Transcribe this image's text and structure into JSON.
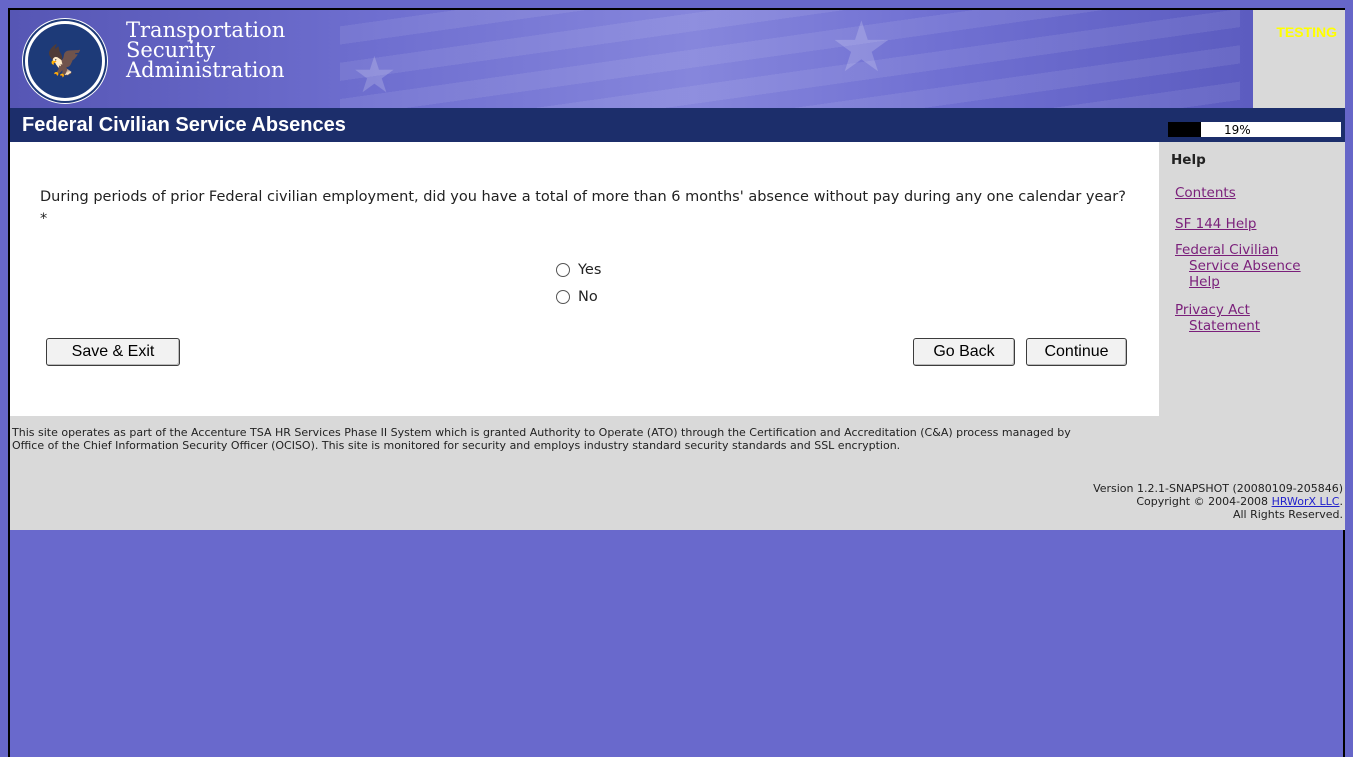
{
  "header": {
    "agency_lines": [
      "Transportation",
      "Security",
      "Administration"
    ],
    "testing_label": "TESTING"
  },
  "title_bar": {
    "title": "Federal Civilian Service Absences",
    "progress_percent": 19,
    "progress_text": "19%"
  },
  "question": {
    "text": "During periods of prior Federal civilian employment, did you have a total of more than 6 months' absence without pay during any one calendar year? *",
    "options": [
      {
        "label": "Yes",
        "selected": false
      },
      {
        "label": "No",
        "selected": false
      }
    ]
  },
  "buttons": {
    "save_exit": "Save & Exit",
    "go_back": "Go Back",
    "continue": "Continue"
  },
  "help": {
    "heading": "Help",
    "links": [
      {
        "line1": "Contents",
        "line2": "",
        "line3": ""
      },
      {
        "line1": "SF 144 Help",
        "line2": "",
        "line3": ""
      },
      {
        "line1": "Federal Civilian",
        "line2": "Service Absence",
        "line3": "Help"
      },
      {
        "line1": "Privacy Act",
        "line2": "Statement",
        "line3": ""
      }
    ]
  },
  "footer": {
    "notice_line1": "This site operates as part of the Accenture TSA HR Services Phase II System which is granted Authority to Operate (ATO) through the Certification and Accreditation (C&A) process managed by",
    "notice_line2": "Office of the Chief Information Security Officer (OCISO). This site is monitored for security and employs industry standard security standards and SSL encryption.",
    "version": "Version 1.2.1-SNAPSHOT (20080109-205846)",
    "copyright_prefix": "Copyright © 2004-2008 ",
    "copyright_link": "HRWorX LLC",
    "copyright_suffix": ".",
    "rights": "All Rights Reserved."
  },
  "colors": {
    "title_bar": "#1c2e6b",
    "page_background": "#6969cc",
    "panel_gray": "#d9d9d9",
    "help_link": "#7a1f7a",
    "testing": "#ffff00"
  },
  "icons": {
    "seal": "dhs-seal-icon"
  }
}
